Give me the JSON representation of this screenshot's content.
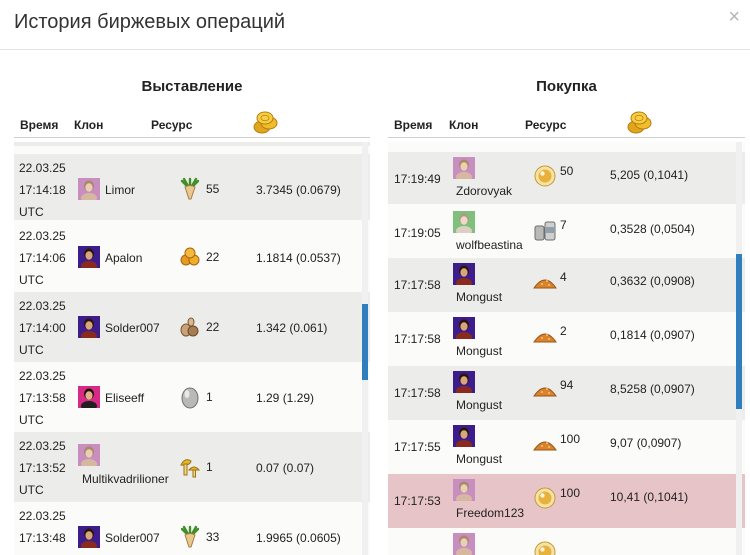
{
  "dialog": {
    "title": "История биржевых операций",
    "close": "×"
  },
  "left": {
    "title": "Выставление",
    "headers": {
      "time": "Время",
      "clone": "Клон",
      "resource": "Ресурс"
    },
    "top_cut": "UTC",
    "rows": [
      {
        "date": "22.03.25",
        "time": "17:14:18",
        "tz": "UTC",
        "clone": "Limor",
        "avatar": "avatar-female",
        "resource": "root-icon",
        "count": "55",
        "price": "3.7345 (0.0679)"
      },
      {
        "date": "22.03.25",
        "time": "17:14:06",
        "tz": "UTC",
        "clone": "Apalon",
        "avatar": "avatar-male",
        "resource": "nuts-icon",
        "count": "22",
        "price": "1.1814 (0.0537)"
      },
      {
        "date": "22.03.25",
        "time": "17:14:00",
        "tz": "UTC",
        "clone": "Solder007",
        "avatar": "avatar-male",
        "resource": "seeds-icon",
        "count": "22",
        "price": "1.342 (0.061)"
      },
      {
        "date": "22.03.25",
        "time": "17:13:58",
        "tz": "UTC",
        "clone": "Eliseeff",
        "avatar": "avatar-pink",
        "resource": "egg-icon",
        "count": "1",
        "price": "1.29 (1.29)"
      },
      {
        "date": "22.03.25",
        "time": "17:13:52",
        "tz": "UTC",
        "clone": "Multikvadrilioner",
        "avatar": "avatar-female",
        "resource": "mushroom-icon",
        "count": "1",
        "price": "0.07 (0.07)"
      },
      {
        "date": "22.03.25",
        "time": "17:13:48",
        "tz": "",
        "clone": "Solder007",
        "avatar": "avatar-male",
        "resource": "root-icon",
        "count": "33",
        "price": "1.9965 (0.0605)"
      }
    ]
  },
  "right": {
    "title": "Покупка",
    "headers": {
      "time": "Время",
      "clone": "Клон",
      "resource": "Ресурс"
    },
    "rows": [
      {
        "time": "17:19:49",
        "clone": "Zdorovyak",
        "avatar": "avatar-female",
        "resource": "pearl-icon",
        "count": "50",
        "price": "5,205 (0,1041)"
      },
      {
        "time": "17:19:05",
        "clone": "wolfbeastina",
        "avatar": "avatar-green",
        "resource": "cans-icon",
        "count": "7",
        "price": "0,3528 (0,0504)"
      },
      {
        "time": "17:17:58",
        "clone": "Mongust",
        "avatar": "avatar-male",
        "resource": "sand-icon",
        "count": "4",
        "price": "0,3632 (0,0908)"
      },
      {
        "time": "17:17:58",
        "clone": "Mongust",
        "avatar": "avatar-male",
        "resource": "sand-icon",
        "count": "2",
        "price": "0,1814 (0,0907)"
      },
      {
        "time": "17:17:58",
        "clone": "Mongust",
        "avatar": "avatar-male",
        "resource": "sand-icon",
        "count": "94",
        "price": "8,5258 (0,0907)"
      },
      {
        "time": "17:17:55",
        "clone": "Mongust",
        "avatar": "avatar-male",
        "resource": "sand-icon",
        "count": "100",
        "price": "9,07 (0,0907)"
      },
      {
        "time": "17:17:53",
        "clone": "Freedom123",
        "avatar": "avatar-female",
        "resource": "pearl-icon",
        "count": "100",
        "price": "10,41 (0,1041)"
      }
    ]
  }
}
